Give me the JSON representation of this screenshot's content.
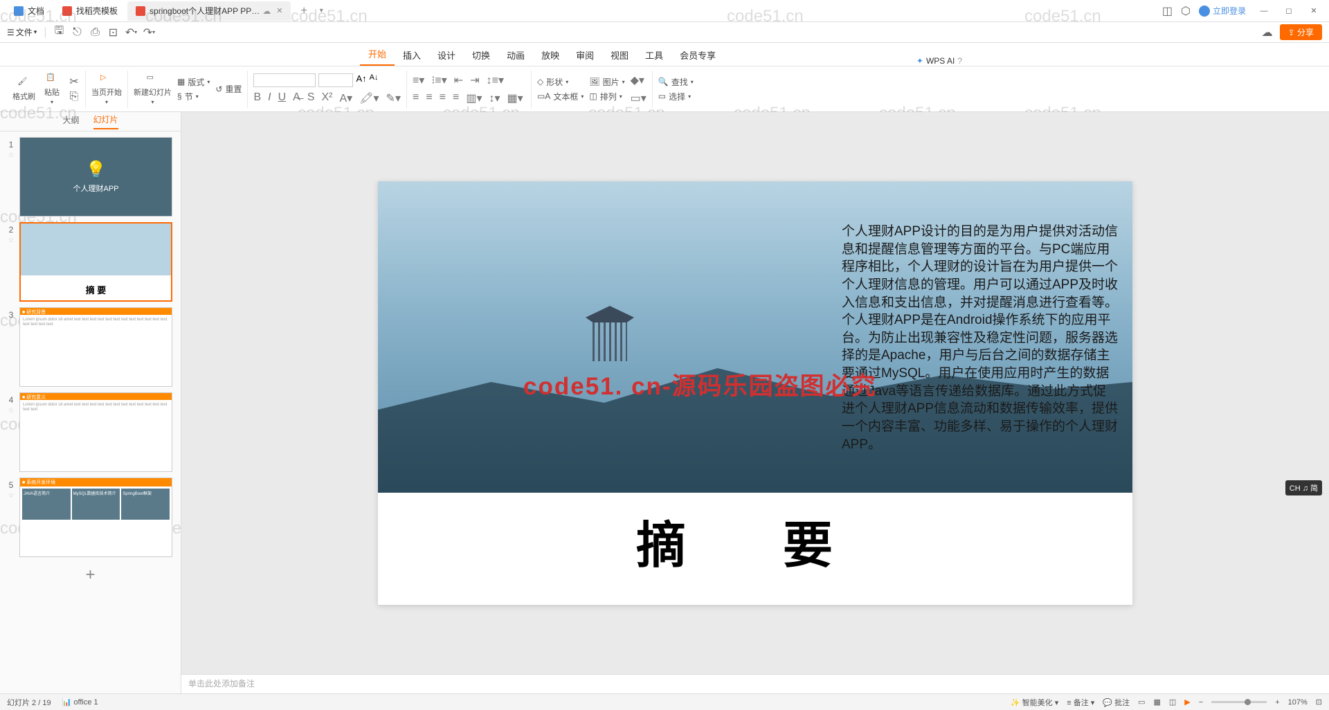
{
  "titlebar": {
    "tabs": [
      {
        "label": "文档",
        "icon": "doc"
      },
      {
        "label": "找稻壳模板",
        "icon": "daoke"
      },
      {
        "label": "springboot个人理财APP PP…",
        "icon": "ppt",
        "active": true
      }
    ],
    "login": "立即登录"
  },
  "toolbar": {
    "file": "文件"
  },
  "menubar": {
    "items": [
      "开始",
      "插入",
      "设计",
      "切换",
      "动画",
      "放映",
      "审阅",
      "视图",
      "工具",
      "会员专享"
    ],
    "active": "开始",
    "wps_ai": "WPS AI"
  },
  "ribbon": {
    "format_painter": "格式刷",
    "paste": "粘贴",
    "from_current": "当页开始",
    "new_slide": "新建幻灯片",
    "layout": "版式",
    "section": "节",
    "reset": "重置",
    "shape": "形状",
    "picture": "图片",
    "textbox": "文本框",
    "arrange": "排列",
    "find": "查找",
    "select": "选择"
  },
  "sidebar": {
    "tabs": {
      "outline": "大纲",
      "slides": "幻灯片"
    },
    "thumbs": {
      "1": "个人理财APP",
      "2": "摘  要",
      "3_bar": "■ 研究背景",
      "4_bar": "■ 研究意义",
      "5_bar": "■ 系统开发环境",
      "5_cells": [
        "JAVA语言简介",
        "MySQL数据库技术简介",
        "SpringBoot框架"
      ]
    },
    "add": "+"
  },
  "slide": {
    "body": "个人理财APP设计的目的是为用户提供对活动信息和提醒信息管理等方面的平台。与PC端应用程序相比，个人理财的设计旨在为用户提供一个个人理财信息的管理。用户可以通过APP及时收入信息和支出信息，并对提醒消息进行查看等。\n个人理财APP是在Android操作系统下的应用平台。为防止出现兼容性及稳定性问题，服务器选择的是Apache，用户与后台之间的数据存储主要通过MySQL。用户在使用应用时产生的数据通过Java等语言传递给数据库。通过此方式促进个人理财APP信息流动和数据传输效率，提供一个内容丰富、功能多样、易于操作的个人理财APP。",
    "watermark": "code51. cn-源码乐园盗图必究",
    "title": "摘 要"
  },
  "notes": "单击此处添加备注",
  "statusbar": {
    "slide_pos": "幻灯片 2 / 19",
    "office": "office 1",
    "beautify": "智能美化",
    "notes": "备注",
    "comments": "批注",
    "zoom": "107%"
  },
  "ime": "CH ♫ 简",
  "share": "分享",
  "watermark_bg": "code51.cn"
}
